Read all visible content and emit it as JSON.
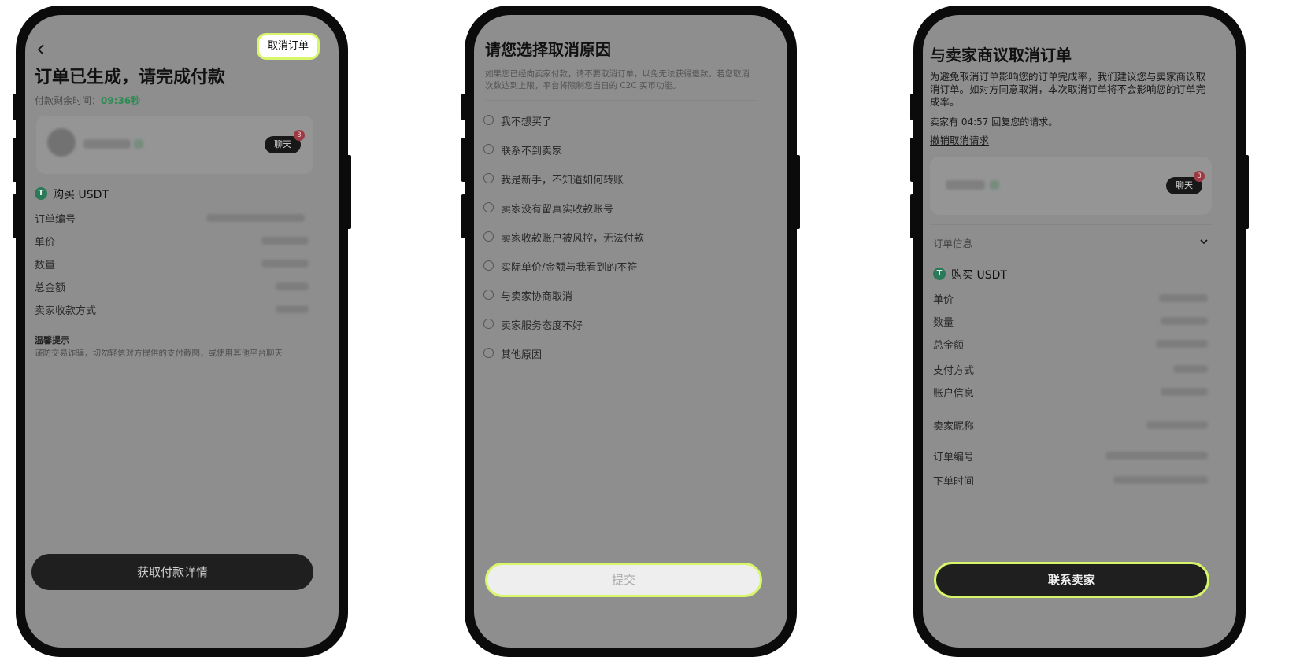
{
  "screen1": {
    "back_icon": "chevron-left-icon",
    "cancel_order_label": "取消订单",
    "title": "订单已生成，请完成付款",
    "countdown_label": "付款剩余时间：",
    "countdown_value": "09:36秒",
    "chat_label": "聊天",
    "chat_badge": "3",
    "asset_title": "购买 USDT",
    "rows": [
      "订单编号",
      "单价",
      "数量",
      "总金额",
      "卖家收款方式"
    ],
    "tips_title": "温馨提示",
    "tips_text": "谨防交易诈骗，切勿轻信对方提供的支付截图，或使用其他平台聊天",
    "primary_button": "获取付款详情"
  },
  "screen2": {
    "title": "请您选择取消原因",
    "notice": [
      "如果您已经向卖家付款，请不要取消订单，以免无法获得退款。若您取消",
      "次数达到上限，平台将限制您当日的 C2C 买币功能。"
    ],
    "reasons": [
      "我不想买了",
      "联系不到卖家",
      "我是新手，不知道如何转账",
      "卖家没有留真实收款账号",
      "卖家收款账户被风控，无法付款",
      "实际单价/金额与我看到的不符",
      "与卖家协商取消",
      "卖家服务态度不好",
      "其他原因"
    ],
    "submit_button": "提交"
  },
  "screen3": {
    "title": "与卖家商议取消订单",
    "description": [
      "为避免取消订单影响您的订单完成率，我们建议您与卖家商议取",
      "消订单。如对方同意取消，本次取消订单将不会影响您的订单完",
      "成率。"
    ],
    "reply_notice": "卖家有 04:57 回复您的请求。",
    "revoke_link": "撤销取消请求",
    "chat_label": "聊天",
    "chat_badge": "3",
    "order_info_label": "订单信息",
    "asset_title": "购买 USDT",
    "rows": [
      "单价",
      "数量",
      "总金额",
      "支付方式",
      "账户信息",
      "卖家昵称",
      "订单编号",
      "下单时间"
    ],
    "primary_button": "联系卖家"
  },
  "colors": {
    "highlight": "#d8f66a",
    "countdown": "#2f8b55",
    "overlay": "#8e8e8e",
    "frame": "#0b0b0b"
  }
}
